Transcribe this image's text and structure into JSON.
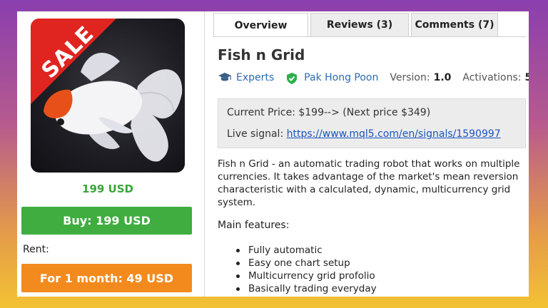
{
  "product": {
    "sale_badge": "SALE",
    "price_under_image": "199 USD",
    "buy_label": "Buy: 199 USD",
    "rent_label": "Rent:",
    "rent_button_label": "For 1 month: 49 USD"
  },
  "tabs": [
    {
      "label": "Overview",
      "active": true
    },
    {
      "label": "Reviews (3)",
      "active": false
    },
    {
      "label": "Comments (7)",
      "active": false
    }
  ],
  "title": "Fish n Grid",
  "meta": {
    "category": "Experts",
    "category_icon": "graduation-cap-icon",
    "author": "Pak Hong Poon",
    "author_icon": "verified-shield-icon",
    "version_label": "Version:",
    "version_value": "1.0",
    "activations_label": "Activations:",
    "activations_value": "5"
  },
  "price_box": {
    "current_price": "Current Price: $199--> (Next price $349)",
    "live_signal_label": "Live signal:",
    "live_signal_url": "https://www.mql5.com/en/signals/1590997"
  },
  "description": "Fish n Grid - an automatic trading robot that works on multiple currencies. It takes advantage of the market's mean reversion characteristic with a calculated, dynamic, multicurrency grid system.",
  "features_title": "Main features:",
  "features": [
    "Fully automatic",
    "Easy one chart setup",
    "Multicurrency grid profolio",
    "Basically trading everyday"
  ],
  "colors": {
    "buy": "#3fad3f",
    "rent": "#f38a1e",
    "sale_ribbon": "#e0241f",
    "link": "#2a6bb3",
    "price_green": "#3aa63a"
  }
}
